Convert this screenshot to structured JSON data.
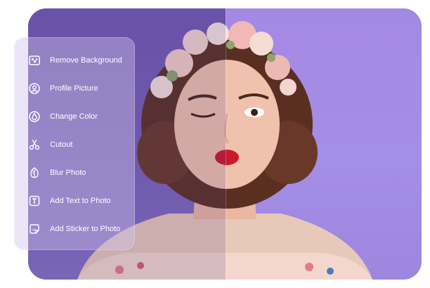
{
  "menu": {
    "items": [
      {
        "label": "Remove Background",
        "icon": "checker-image-icon"
      },
      {
        "label": "Profile Picture",
        "icon": "user-circle-icon"
      },
      {
        "label": "Change Color",
        "icon": "drop-icon"
      },
      {
        "label": "Cutout",
        "icon": "scissors-icon"
      },
      {
        "label": "Blur Photo",
        "icon": "blur-leaf-icon"
      },
      {
        "label": "Add Text to Photo",
        "icon": "text-box-icon"
      },
      {
        "label": "Add Sticker to Photo",
        "icon": "sticker-icon"
      }
    ]
  },
  "colors": {
    "left_background": "#7862b9",
    "right_background": "#a58ee6",
    "menu_text": "#ffffff"
  }
}
